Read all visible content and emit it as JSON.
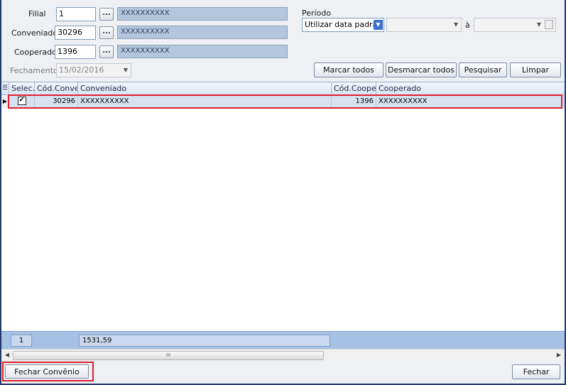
{
  "filters": {
    "filial_label": "Filial",
    "filial_value": "1",
    "filial_name": "XXXXXXXXXX",
    "conveniado_label": "Conveniado",
    "conveniado_value": "30296",
    "conveniado_name": "XXXXXXXXXX",
    "cooperado_label": "Cooperado",
    "cooperado_value": "1396",
    "cooperado_name": "XXXXXXXXXX",
    "fechamento_label": "Fechamento",
    "fechamento_value": "15/02/2016",
    "lookup_button": "...",
    "periodo_label": "Período",
    "periodo_option": "Utilizar data padrão",
    "periodo_between": "à"
  },
  "actions": {
    "marcar_todos": "Marcar todos",
    "desmarcar_todos": "Desmarcar todos",
    "pesquisar": "Pesquisar",
    "limpar": "Limpar"
  },
  "grid": {
    "columns": [
      "Selec.",
      "Cód.Conver",
      "Conveniado",
      "Cód.Cooper",
      "Cooperado"
    ],
    "rows": [
      {
        "selected": true,
        "cod_conver": "30296",
        "conveniado": "XXXXXXXXXX",
        "cod_cooper": "1396",
        "cooperado": "XXXXXXXXXX"
      }
    ],
    "footer_count": "1",
    "footer_total": "1531,59",
    "scroll_grip": "III"
  },
  "buttons": {
    "fechar_convenio": "Fechar Convênio",
    "fechar": "Fechar"
  },
  "colors": {
    "highlight": "#e0202f",
    "selection_row": "#d6e2f2",
    "footer": "#a5c1e4"
  }
}
